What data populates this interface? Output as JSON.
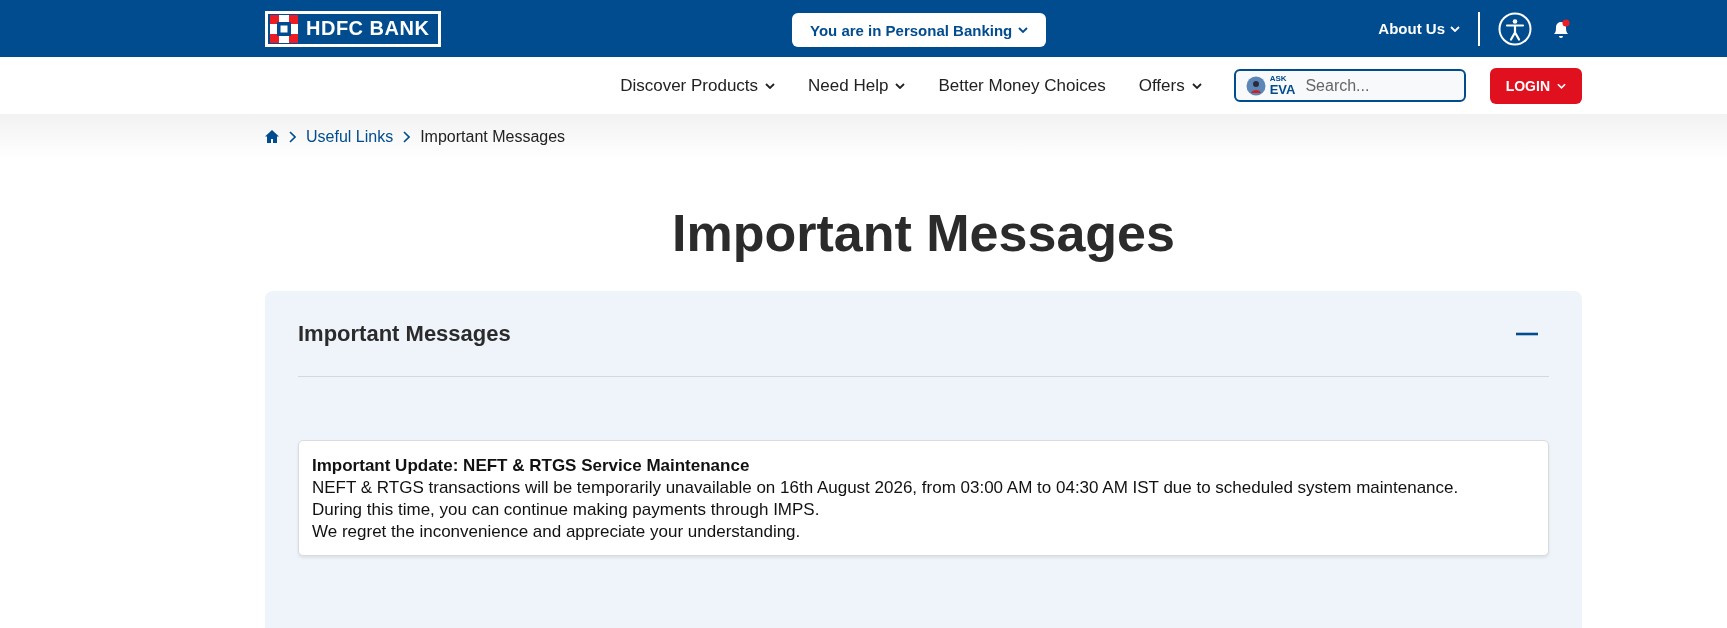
{
  "top_bar": {
    "logo": "HDFC BANK",
    "segment_selector": "You are in Personal Banking",
    "about": "About Us",
    "notification_unread": true
  },
  "nav": {
    "items": [
      {
        "label": "Discover Products",
        "has_menu": true
      },
      {
        "label": "Need Help",
        "has_menu": true
      },
      {
        "label": "Better Money Choices",
        "has_menu": false
      },
      {
        "label": "Offers",
        "has_menu": true
      }
    ],
    "search": {
      "badge_top": "ASK",
      "badge_bottom": "EVA",
      "placeholder": "Search..."
    },
    "login": "LOGIN"
  },
  "breadcrumb": [
    {
      "label": "Useful Links",
      "kind": "link"
    },
    {
      "label": "Important Messages",
      "kind": "current"
    }
  ],
  "page_title": "Important Messages",
  "accordion": {
    "title": "Important Messages",
    "expanded": true,
    "message": {
      "heading": "Important Update: NEFT & RTGS Service Maintenance",
      "lines": [
        "NEFT & RTGS transactions will be temporarily unavailable on 16th August 2026, from 03:00 AM to 04:30 AM IST due to scheduled system maintenance.",
        "During this time, you can continue making payments through IMPS.",
        "We regret the inconvenience and appreciate your understanding."
      ]
    }
  }
}
